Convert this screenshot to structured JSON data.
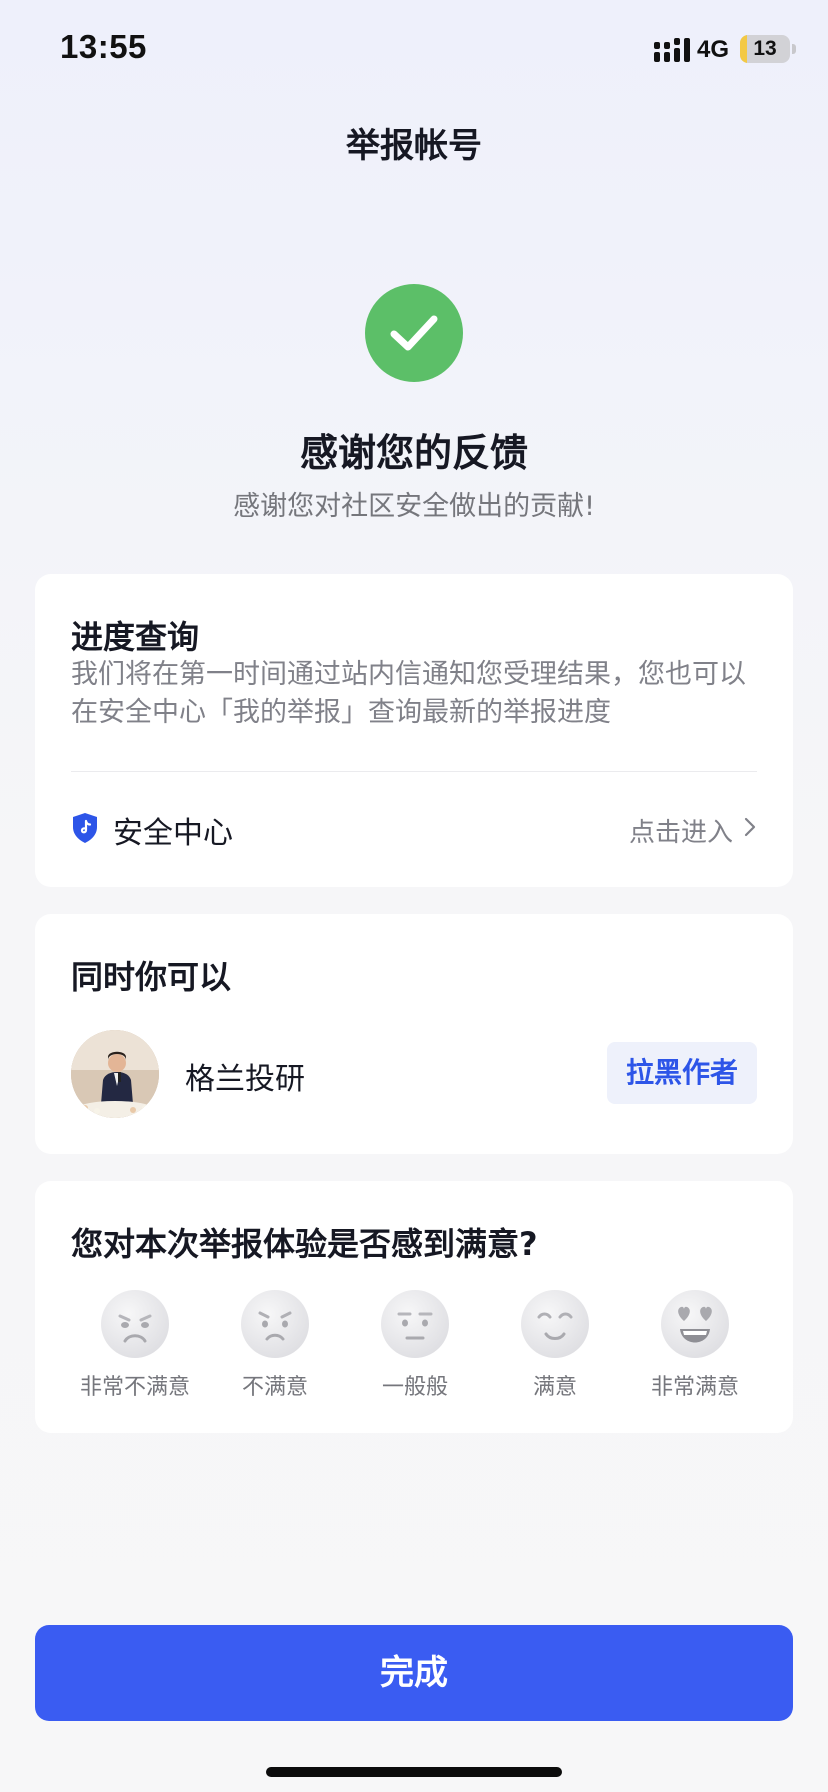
{
  "status_bar": {
    "time": "13:55",
    "network": "4G",
    "battery": "13",
    "battery_level_percent": 13,
    "battery_accent": "#f3c945"
  },
  "nav": {
    "title": "举报帐号"
  },
  "result": {
    "icon": "check-circle-icon",
    "accent": "#5cbf68",
    "title": "感谢您的反馈",
    "subtitle": "感谢您对社区安全做出的贡献!"
  },
  "progress": {
    "title": "进度查询",
    "description": "我们将在第一时间通过站内信通知您受理结果，您也可以在安全中心「我的举报」查询最新的举报进度",
    "security_center_label": "安全中心",
    "enter_label": "点击进入",
    "icon": "shield-icon"
  },
  "also": {
    "title": "同时你可以",
    "author_name": "格兰投研",
    "block_label": "拉黑作者",
    "accent": "#2d55e8"
  },
  "rating": {
    "title": "您对本次举报体验是否感到满意?",
    "options": [
      {
        "label": "非常不满意",
        "icon": "very-unsatisfied-face-icon"
      },
      {
        "label": "不满意",
        "icon": "unsatisfied-face-icon"
      },
      {
        "label": "一般般",
        "icon": "neutral-face-icon"
      },
      {
        "label": "满意",
        "icon": "satisfied-face-icon"
      },
      {
        "label": "非常满意",
        "icon": "very-satisfied-face-icon"
      }
    ]
  },
  "footer": {
    "done_label": "完成",
    "accent": "#3a5cf2"
  }
}
